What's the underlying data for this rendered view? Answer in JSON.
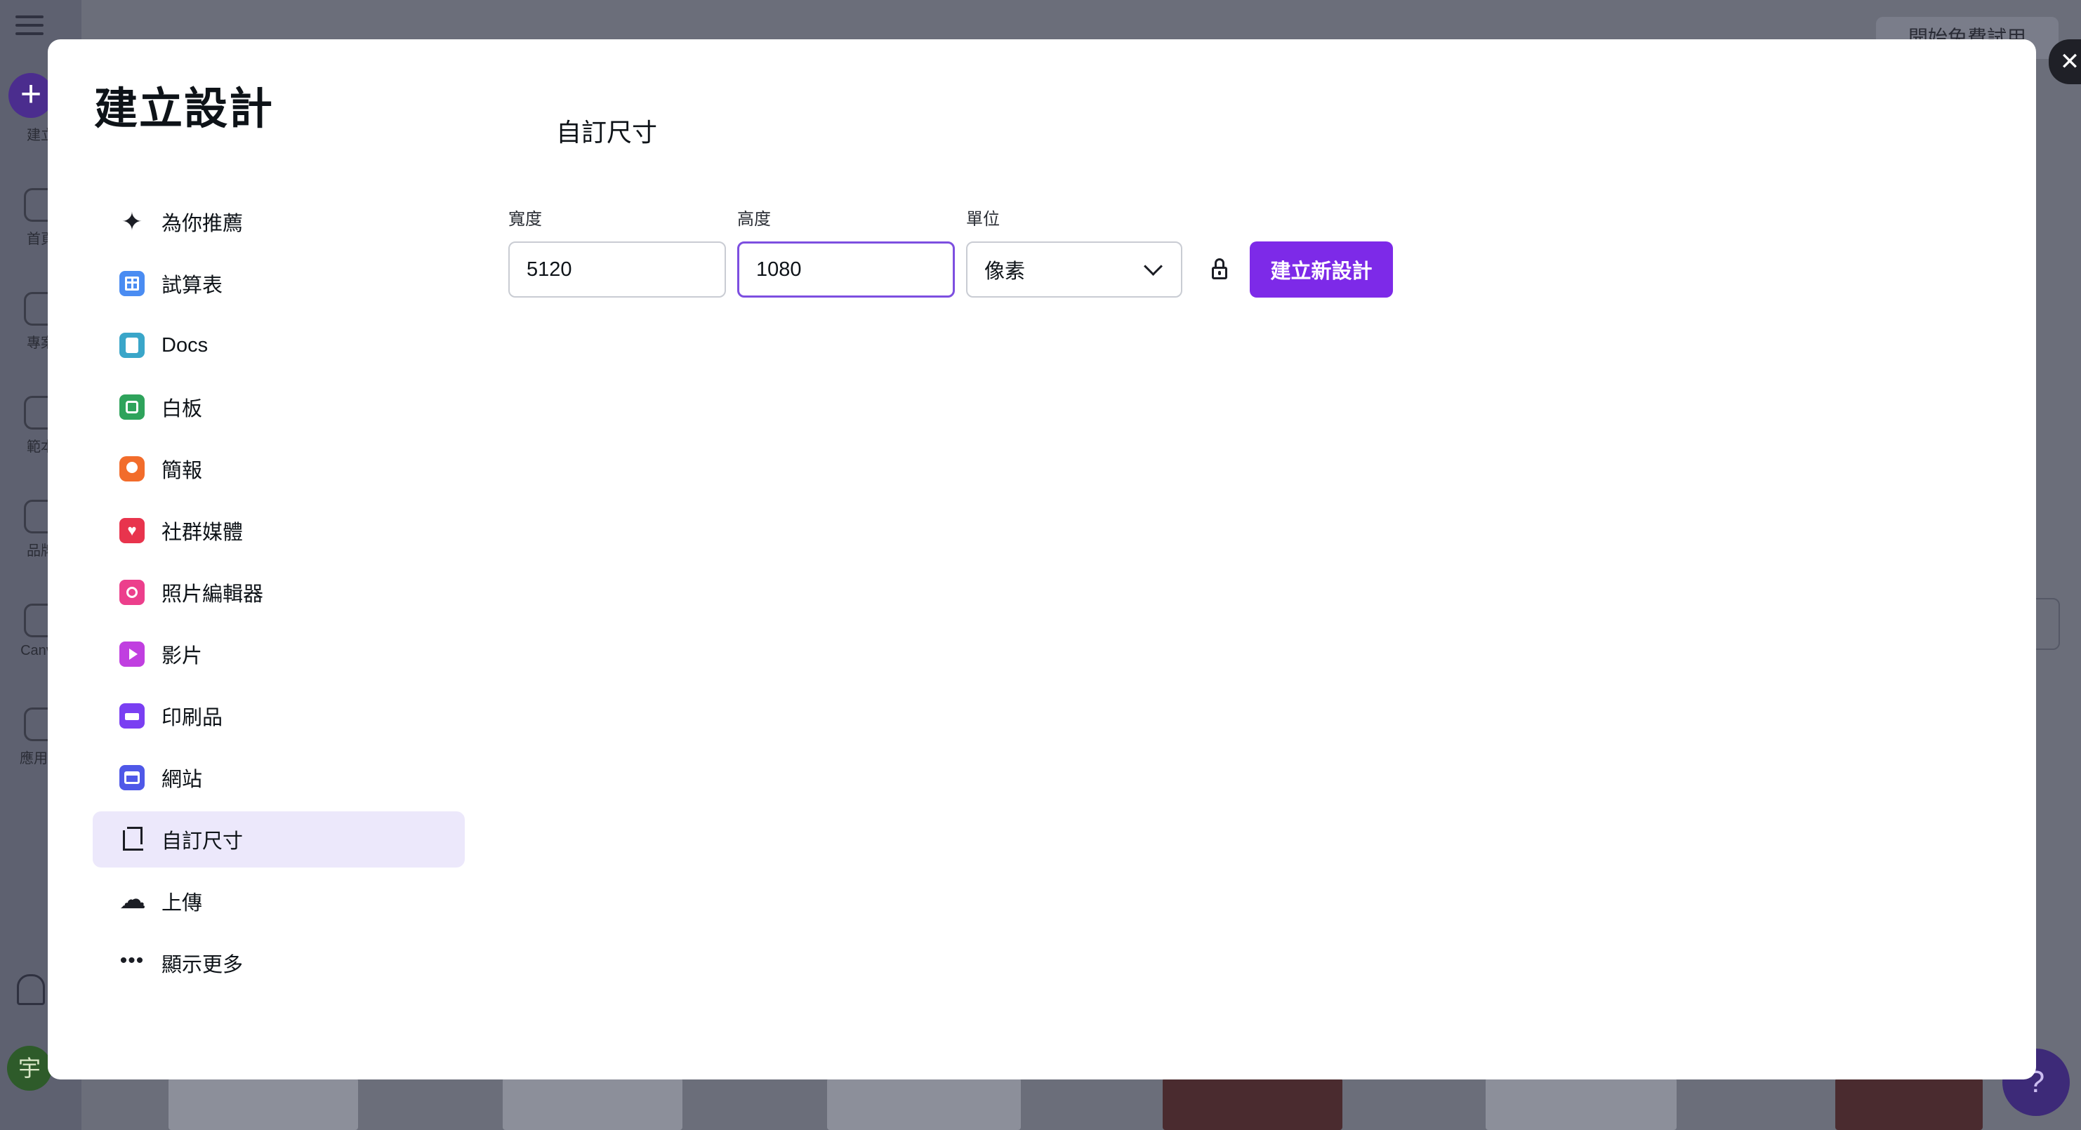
{
  "background": {
    "rail_labels": [
      "建立",
      "首頁",
      "專案",
      "範本",
      "品牌",
      "Canva",
      "應用程"
    ],
    "avatar_initial": "宇",
    "top_button": "開始免費試用",
    "help_label": "?"
  },
  "modal": {
    "title": "建立設計",
    "close_label": "✕",
    "nav": [
      {
        "label": "為你推薦",
        "icon": "sparkle-icon"
      },
      {
        "label": "試算表",
        "icon": "spreadsheet-icon"
      },
      {
        "label": "Docs",
        "icon": "docs-icon"
      },
      {
        "label": "白板",
        "icon": "whiteboard-icon"
      },
      {
        "label": "簡報",
        "icon": "presentation-icon"
      },
      {
        "label": "社群媒體",
        "icon": "social-media-icon"
      },
      {
        "label": "照片編輯器",
        "icon": "photo-editor-icon"
      },
      {
        "label": "影片",
        "icon": "video-icon"
      },
      {
        "label": "印刷品",
        "icon": "print-icon"
      },
      {
        "label": "網站",
        "icon": "website-icon"
      },
      {
        "label": "自訂尺寸",
        "icon": "custom-size-icon",
        "active": true
      },
      {
        "label": "上傳",
        "icon": "upload-icon"
      },
      {
        "label": "顯示更多",
        "icon": "more-icon"
      }
    ],
    "custom_size": {
      "title": "自訂尺寸",
      "width_label": "寬度",
      "width_value": "5120",
      "height_label": "高度",
      "height_value": "1080",
      "unit_label": "單位",
      "unit_value": "像素",
      "create_button": "建立新設計"
    }
  },
  "colors": {
    "accent": "#7d2ae8",
    "active_nav_bg": "#ece8fb",
    "focus_border": "#7d4fe0"
  }
}
